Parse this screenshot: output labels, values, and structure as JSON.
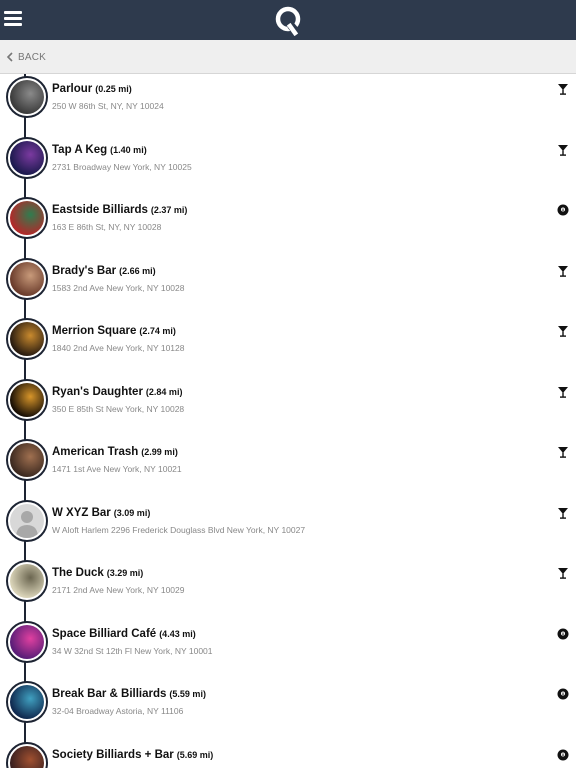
{
  "header": {
    "menu_icon": "hamburger-menu-icon",
    "logo_icon": "app-logo-icon"
  },
  "nav": {
    "back_label": "BACK",
    "back_icon": "chevron-left-icon"
  },
  "venues": [
    {
      "name": "Parlour",
      "distance": "(0.25 mi)",
      "address": "250 W 86th St, NY, NY 10024",
      "type_icon": "cocktail-glass-icon",
      "thumb": [
        "#3b3b3b",
        "#8a8a8a"
      ]
    },
    {
      "name": "Tap A Keg",
      "distance": "(1.40 mi)",
      "address": "2731 Broadway New York, NY 10025",
      "type_icon": "cocktail-glass-icon",
      "thumb": [
        "#1c1a4e",
        "#7b3aa0"
      ]
    },
    {
      "name": "Eastside Billiards",
      "distance": "(2.37 mi)",
      "address": "163 E 86th St, NY, NY 10028",
      "type_icon": "billiard-ball-icon",
      "thumb": [
        "#b02a2a",
        "#2f7d4f"
      ]
    },
    {
      "name": "Brady's Bar",
      "distance": "(2.66 mi)",
      "address": "1583 2nd Ave New York, NY 10028",
      "type_icon": "cocktail-glass-icon",
      "thumb": [
        "#6b3c2c",
        "#c89a7a"
      ]
    },
    {
      "name": "Merrion Square",
      "distance": "(2.74 mi)",
      "address": "1840 2nd Ave New York, NY 10128",
      "type_icon": "cocktail-glass-icon",
      "thumb": [
        "#2a1c10",
        "#c98a2e"
      ]
    },
    {
      "name": "Ryan's Daughter",
      "distance": "(2.84 mi)",
      "address": "350 E 85th St New York, NY 10028",
      "type_icon": "cocktail-glass-icon",
      "thumb": [
        "#1a1005",
        "#d7952a"
      ]
    },
    {
      "name": "American Trash",
      "distance": "(2.99 mi)",
      "address": "1471 1st Ave New York, NY 10021",
      "type_icon": "cocktail-glass-icon",
      "thumb": [
        "#3d2a20",
        "#a07050"
      ]
    },
    {
      "name": "W XYZ Bar",
      "distance": "(3.09 mi)",
      "address": "W Aloft Harlem 2296 Frederick Douglass Blvd New York, NY 10027",
      "type_icon": "cocktail-glass-icon",
      "thumb": [
        "#d8d8d8",
        "#a8a8a8"
      ],
      "placeholder": true
    },
    {
      "name": "The Duck",
      "distance": "(3.29 mi)",
      "address": "2171 2nd Ave New York, NY 10029",
      "type_icon": "cocktail-glass-icon",
      "thumb": [
        "#d9d3b8",
        "#6b6650"
      ]
    },
    {
      "name": "Space Billiard Café",
      "distance": "(4.43 mi)",
      "address": "34 W 32nd St 12th Fl New York, NY 10001",
      "type_icon": "billiard-ball-icon",
      "thumb": [
        "#5a1e78",
        "#e040a0"
      ]
    },
    {
      "name": "Break Bar & Billiards",
      "distance": "(5.59 mi)",
      "address": "32-04 Broadway Astoria, NY 11106",
      "type_icon": "billiard-ball-icon",
      "thumb": [
        "#102a50",
        "#40a0c0"
      ]
    },
    {
      "name": "Society Billiards + Bar",
      "distance": "(5.69 mi)",
      "address": "",
      "type_icon": "billiard-ball-icon",
      "thumb": [
        "#3a2020",
        "#a05030"
      ]
    }
  ]
}
